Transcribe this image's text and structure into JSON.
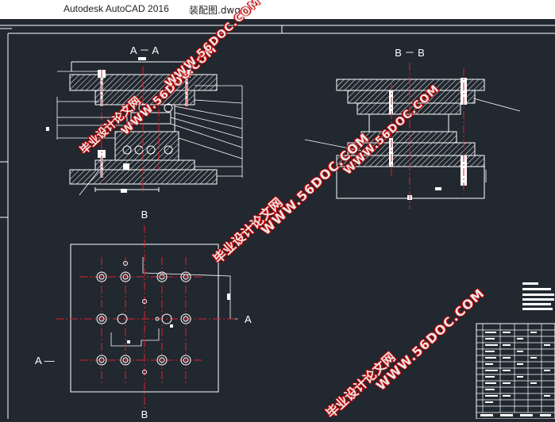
{
  "window": {
    "app_title": "Autodesk AutoCAD 2016",
    "file_name": "装配图.dwg"
  },
  "drawing": {
    "section_aa_title": "A － A",
    "section_bb_title": "B － B",
    "plan_label_b_top": "B",
    "plan_label_b_bottom": "B",
    "plan_label_a_right": "A",
    "plan_label_a_left": "A —"
  },
  "watermarks": [
    {
      "text": "毕业设计论文网"
    },
    {
      "text": "WWW.56DOC.COM"
    }
  ],
  "colors": {
    "background": "#212830",
    "line": "#ffffff",
    "center_line": "#e0202a",
    "watermark_stroke": "#cc0000"
  }
}
